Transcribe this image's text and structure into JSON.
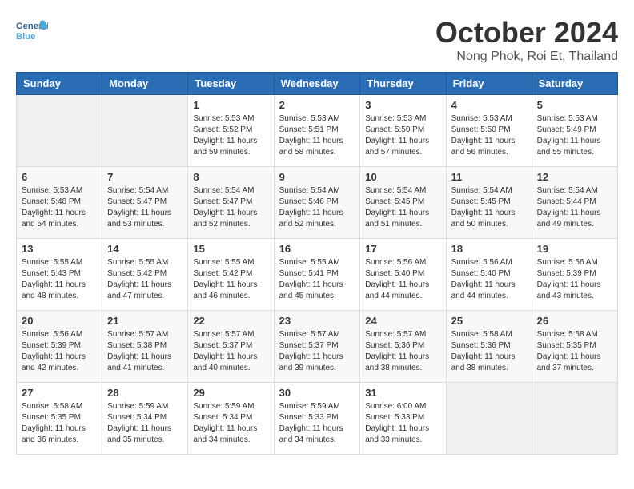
{
  "header": {
    "logo": {
      "general": "General",
      "blue": "Blue"
    },
    "title": "October 2024",
    "location": "Nong Phok, Roi Et, Thailand"
  },
  "days_of_week": [
    "Sunday",
    "Monday",
    "Tuesday",
    "Wednesday",
    "Thursday",
    "Friday",
    "Saturday"
  ],
  "weeks": [
    [
      {
        "day": "",
        "sunrise": "",
        "sunset": "",
        "daylight": ""
      },
      {
        "day": "",
        "sunrise": "",
        "sunset": "",
        "daylight": ""
      },
      {
        "day": "1",
        "sunrise": "Sunrise: 5:53 AM",
        "sunset": "Sunset: 5:52 PM",
        "daylight": "Daylight: 11 hours and 59 minutes."
      },
      {
        "day": "2",
        "sunrise": "Sunrise: 5:53 AM",
        "sunset": "Sunset: 5:51 PM",
        "daylight": "Daylight: 11 hours and 58 minutes."
      },
      {
        "day": "3",
        "sunrise": "Sunrise: 5:53 AM",
        "sunset": "Sunset: 5:50 PM",
        "daylight": "Daylight: 11 hours and 57 minutes."
      },
      {
        "day": "4",
        "sunrise": "Sunrise: 5:53 AM",
        "sunset": "Sunset: 5:50 PM",
        "daylight": "Daylight: 11 hours and 56 minutes."
      },
      {
        "day": "5",
        "sunrise": "Sunrise: 5:53 AM",
        "sunset": "Sunset: 5:49 PM",
        "daylight": "Daylight: 11 hours and 55 minutes."
      }
    ],
    [
      {
        "day": "6",
        "sunrise": "Sunrise: 5:53 AM",
        "sunset": "Sunset: 5:48 PM",
        "daylight": "Daylight: 11 hours and 54 minutes."
      },
      {
        "day": "7",
        "sunrise": "Sunrise: 5:54 AM",
        "sunset": "Sunset: 5:47 PM",
        "daylight": "Daylight: 11 hours and 53 minutes."
      },
      {
        "day": "8",
        "sunrise": "Sunrise: 5:54 AM",
        "sunset": "Sunset: 5:47 PM",
        "daylight": "Daylight: 11 hours and 52 minutes."
      },
      {
        "day": "9",
        "sunrise": "Sunrise: 5:54 AM",
        "sunset": "Sunset: 5:46 PM",
        "daylight": "Daylight: 11 hours and 52 minutes."
      },
      {
        "day": "10",
        "sunrise": "Sunrise: 5:54 AM",
        "sunset": "Sunset: 5:45 PM",
        "daylight": "Daylight: 11 hours and 51 minutes."
      },
      {
        "day": "11",
        "sunrise": "Sunrise: 5:54 AM",
        "sunset": "Sunset: 5:45 PM",
        "daylight": "Daylight: 11 hours and 50 minutes."
      },
      {
        "day": "12",
        "sunrise": "Sunrise: 5:54 AM",
        "sunset": "Sunset: 5:44 PM",
        "daylight": "Daylight: 11 hours and 49 minutes."
      }
    ],
    [
      {
        "day": "13",
        "sunrise": "Sunrise: 5:55 AM",
        "sunset": "Sunset: 5:43 PM",
        "daylight": "Daylight: 11 hours and 48 minutes."
      },
      {
        "day": "14",
        "sunrise": "Sunrise: 5:55 AM",
        "sunset": "Sunset: 5:42 PM",
        "daylight": "Daylight: 11 hours and 47 minutes."
      },
      {
        "day": "15",
        "sunrise": "Sunrise: 5:55 AM",
        "sunset": "Sunset: 5:42 PM",
        "daylight": "Daylight: 11 hours and 46 minutes."
      },
      {
        "day": "16",
        "sunrise": "Sunrise: 5:55 AM",
        "sunset": "Sunset: 5:41 PM",
        "daylight": "Daylight: 11 hours and 45 minutes."
      },
      {
        "day": "17",
        "sunrise": "Sunrise: 5:56 AM",
        "sunset": "Sunset: 5:40 PM",
        "daylight": "Daylight: 11 hours and 44 minutes."
      },
      {
        "day": "18",
        "sunrise": "Sunrise: 5:56 AM",
        "sunset": "Sunset: 5:40 PM",
        "daylight": "Daylight: 11 hours and 44 minutes."
      },
      {
        "day": "19",
        "sunrise": "Sunrise: 5:56 AM",
        "sunset": "Sunset: 5:39 PM",
        "daylight": "Daylight: 11 hours and 43 minutes."
      }
    ],
    [
      {
        "day": "20",
        "sunrise": "Sunrise: 5:56 AM",
        "sunset": "Sunset: 5:39 PM",
        "daylight": "Daylight: 11 hours and 42 minutes."
      },
      {
        "day": "21",
        "sunrise": "Sunrise: 5:57 AM",
        "sunset": "Sunset: 5:38 PM",
        "daylight": "Daylight: 11 hours and 41 minutes."
      },
      {
        "day": "22",
        "sunrise": "Sunrise: 5:57 AM",
        "sunset": "Sunset: 5:37 PM",
        "daylight": "Daylight: 11 hours and 40 minutes."
      },
      {
        "day": "23",
        "sunrise": "Sunrise: 5:57 AM",
        "sunset": "Sunset: 5:37 PM",
        "daylight": "Daylight: 11 hours and 39 minutes."
      },
      {
        "day": "24",
        "sunrise": "Sunrise: 5:57 AM",
        "sunset": "Sunset: 5:36 PM",
        "daylight": "Daylight: 11 hours and 38 minutes."
      },
      {
        "day": "25",
        "sunrise": "Sunrise: 5:58 AM",
        "sunset": "Sunset: 5:36 PM",
        "daylight": "Daylight: 11 hours and 38 minutes."
      },
      {
        "day": "26",
        "sunrise": "Sunrise: 5:58 AM",
        "sunset": "Sunset: 5:35 PM",
        "daylight": "Daylight: 11 hours and 37 minutes."
      }
    ],
    [
      {
        "day": "27",
        "sunrise": "Sunrise: 5:58 AM",
        "sunset": "Sunset: 5:35 PM",
        "daylight": "Daylight: 11 hours and 36 minutes."
      },
      {
        "day": "28",
        "sunrise": "Sunrise: 5:59 AM",
        "sunset": "Sunset: 5:34 PM",
        "daylight": "Daylight: 11 hours and 35 minutes."
      },
      {
        "day": "29",
        "sunrise": "Sunrise: 5:59 AM",
        "sunset": "Sunset: 5:34 PM",
        "daylight": "Daylight: 11 hours and 34 minutes."
      },
      {
        "day": "30",
        "sunrise": "Sunrise: 5:59 AM",
        "sunset": "Sunset: 5:33 PM",
        "daylight": "Daylight: 11 hours and 34 minutes."
      },
      {
        "day": "31",
        "sunrise": "Sunrise: 6:00 AM",
        "sunset": "Sunset: 5:33 PM",
        "daylight": "Daylight: 11 hours and 33 minutes."
      },
      {
        "day": "",
        "sunrise": "",
        "sunset": "",
        "daylight": ""
      },
      {
        "day": "",
        "sunrise": "",
        "sunset": "",
        "daylight": ""
      }
    ]
  ]
}
